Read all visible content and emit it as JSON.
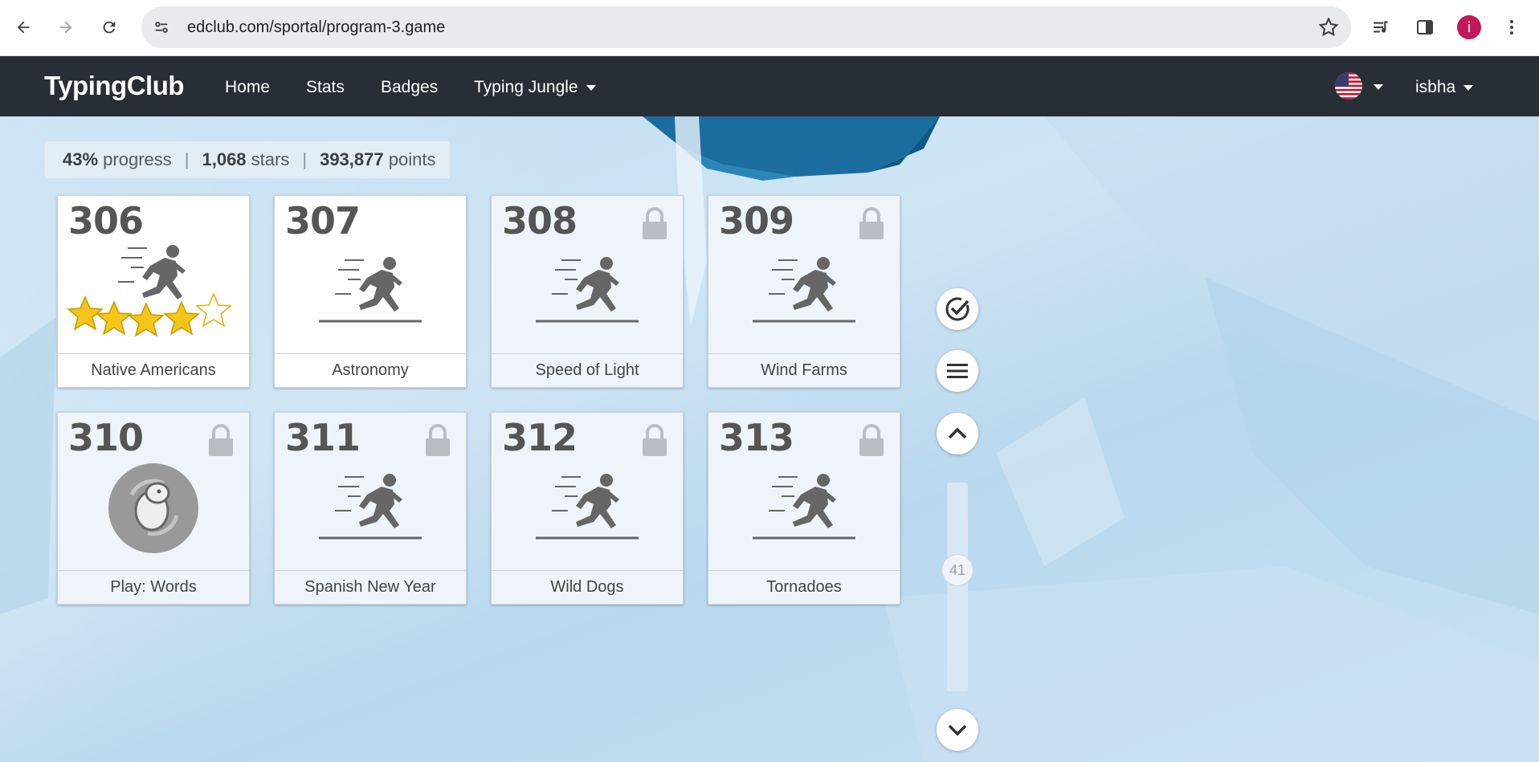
{
  "browser": {
    "url": "edclub.com/sportal/program-3.game",
    "profile_initial": "i"
  },
  "navbar": {
    "brand": "TypingClub",
    "links": [
      {
        "label": "Home"
      },
      {
        "label": "Stats"
      },
      {
        "label": "Badges"
      },
      {
        "label": "Typing Jungle"
      }
    ],
    "user": "isbha",
    "language_flag": "us-flag-icon"
  },
  "stats": {
    "progress_value": "43%",
    "progress_label": "progress",
    "stars_value": "1,068",
    "stars_label": "stars",
    "points_value": "393,877",
    "points_label": "points"
  },
  "lessons": [
    {
      "number": "306",
      "title": "Native Americans",
      "locked": false,
      "stars_earned": 4,
      "stars_total": 5
    },
    {
      "number": "307",
      "title": "Astronomy",
      "locked": false
    },
    {
      "number": "308",
      "title": "Speed of Light",
      "locked": true
    },
    {
      "number": "309",
      "title": "Wind Farms",
      "locked": true
    },
    {
      "number": "310",
      "title": "Play: Words",
      "locked": true,
      "icon": "game-badge-icon"
    },
    {
      "number": "311",
      "title": "Spanish New Year",
      "locked": true
    },
    {
      "number": "312",
      "title": "Wild Dogs",
      "locked": true
    },
    {
      "number": "313",
      "title": "Tornadoes",
      "locked": true
    }
  ],
  "sidebar": {
    "scroll_position_label": "41"
  },
  "colors": {
    "navbar": "#272e36",
    "star_gold": "#f5c518",
    "profile": "#c2185b"
  }
}
